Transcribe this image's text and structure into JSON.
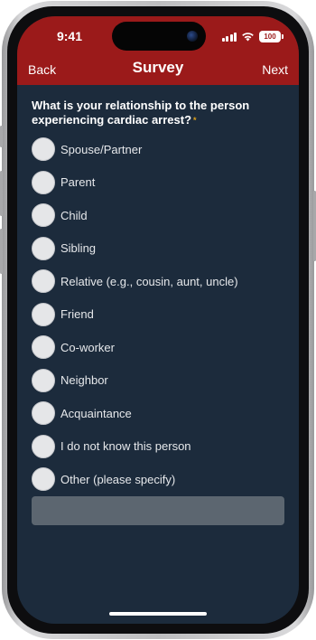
{
  "status_bar": {
    "time": "9:41",
    "battery": "100",
    "icons": [
      "cellular-signal-icon",
      "wifi-icon",
      "battery-icon"
    ]
  },
  "nav": {
    "back_label": "Back",
    "title": "Survey",
    "next_label": "Next"
  },
  "question": {
    "text": "What is your relationship to the person experiencing cardiac arrest?",
    "required_marker": "*"
  },
  "options": [
    {
      "label": "Spouse/Partner",
      "selected": false
    },
    {
      "label": "Parent",
      "selected": false
    },
    {
      "label": "Child",
      "selected": false
    },
    {
      "label": "Sibling",
      "selected": false
    },
    {
      "label": "Relative (e.g., cousin, aunt, uncle)",
      "selected": false
    },
    {
      "label": "Friend",
      "selected": false
    },
    {
      "label": "Co-worker",
      "selected": false
    },
    {
      "label": "Neighbor",
      "selected": false
    },
    {
      "label": "Acquaintance",
      "selected": false
    },
    {
      "label": "I do not know this person",
      "selected": false
    },
    {
      "label": "Other (please specify)",
      "selected": false
    }
  ],
  "specify_input": {
    "value": "",
    "placeholder": ""
  },
  "colors": {
    "header": "#9b1a1a",
    "background": "#1c2b3c",
    "radio": "#e5e6e8",
    "required": "#e0a21a",
    "input": "#5c6670"
  }
}
